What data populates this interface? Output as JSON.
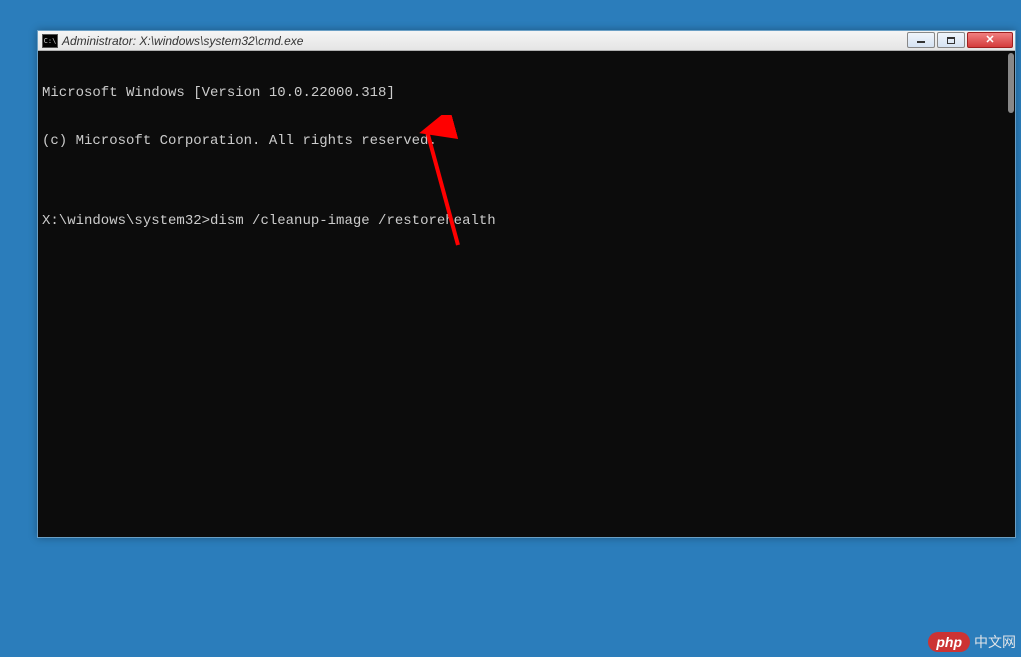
{
  "window": {
    "title": "Administrator: X:\\windows\\system32\\cmd.exe",
    "icon_label": "C:\\"
  },
  "terminal": {
    "line1": "Microsoft Windows [Version 10.0.22000.318]",
    "line2": "(c) Microsoft Corporation. All rights reserved.",
    "blank": "",
    "prompt": "X:\\windows\\system32>",
    "command": "dism /cleanup-image /restorehealth"
  },
  "watermark": {
    "logo": "php",
    "text": "中文网"
  }
}
